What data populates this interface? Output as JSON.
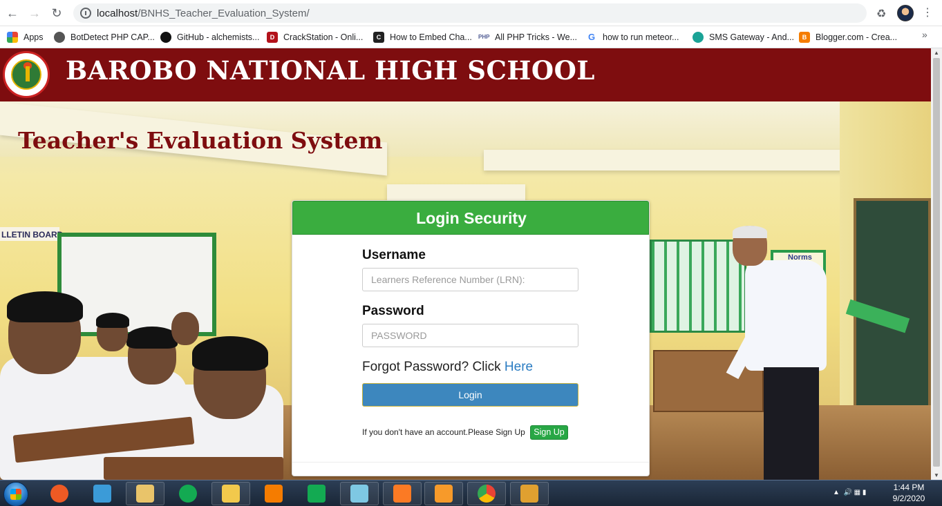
{
  "browser": {
    "url_host": "localhost",
    "url_path": "/BNHS_Teacher_Evaluation_System/",
    "bookmarks": [
      {
        "label": "Apps",
        "icon": "apps-grid-icon",
        "color": "#e8453c"
      },
      {
        "label": "BotDetect PHP CAP...",
        "icon": "botdetect-icon",
        "color": "#555555"
      },
      {
        "label": "GitHub - alchemists...",
        "icon": "github-icon",
        "color": "#111111"
      },
      {
        "label": "CrackStation - Onli...",
        "icon": "crackstation-icon",
        "color": "#b3121b"
      },
      {
        "label": "How to Embed Cha...",
        "icon": "chart-embed-icon",
        "color": "#222222"
      },
      {
        "label": "All PHP Tricks - We...",
        "icon": "php-icon",
        "color": "#4f5b93"
      },
      {
        "label": "how to run meteor...",
        "icon": "google-icon",
        "color": "#4285f4"
      },
      {
        "label": "SMS Gateway - And...",
        "icon": "sms-gateway-icon",
        "color": "#1aa396"
      },
      {
        "label": "Blogger.com - Crea...",
        "icon": "blogger-icon",
        "color": "#f57d00"
      }
    ]
  },
  "header": {
    "school_name": "BAROBO NATIONAL HIGH SCHOOL",
    "page_title": "Teacher's Evaluation System",
    "color": "#7e0d0f"
  },
  "background_signs": {
    "bulletin": "LLETIN BOARD",
    "norms": "Norms\nndards"
  },
  "login": {
    "title": "Login Security",
    "username_label": "Username",
    "username_placeholder": "Learners Reference Number (LRN):",
    "password_label": "Password",
    "password_placeholder": "PASSWORD",
    "forgot_text": "Forgot Password? Click ",
    "forgot_link": "Here",
    "login_button": "Login",
    "signup_text": "If you don't have an account.Please Sign Up",
    "signup_button": "Sign Up",
    "header_color": "#3aad3f",
    "button_color": "#3d87be"
  },
  "taskbar": {
    "apps": [
      {
        "name": "brackets-app",
        "color": "#ee5a24"
      },
      {
        "name": "git-app",
        "color": "#3b9bd8"
      },
      {
        "name": "explorer-app",
        "color": "#e9c46a"
      },
      {
        "name": "mongodb-app",
        "color": "#13aa52"
      },
      {
        "name": "file-manager-app",
        "color": "#f2c94c"
      },
      {
        "name": "vlc-app",
        "color": "#f57c00"
      },
      {
        "name": "mongodb-compass-app",
        "color": "#13aa52"
      },
      {
        "name": "notepad-app",
        "color": "#7ec8e3"
      },
      {
        "name": "xampp-app",
        "color": "#fb7a24"
      },
      {
        "name": "sublime-text-app",
        "color": "#f79a2a"
      },
      {
        "name": "chrome-app",
        "color": "#4285f4"
      },
      {
        "name": "paint-app",
        "color": "#e0a030"
      }
    ],
    "time": "1:44 PM",
    "date": "9/2/2020"
  }
}
